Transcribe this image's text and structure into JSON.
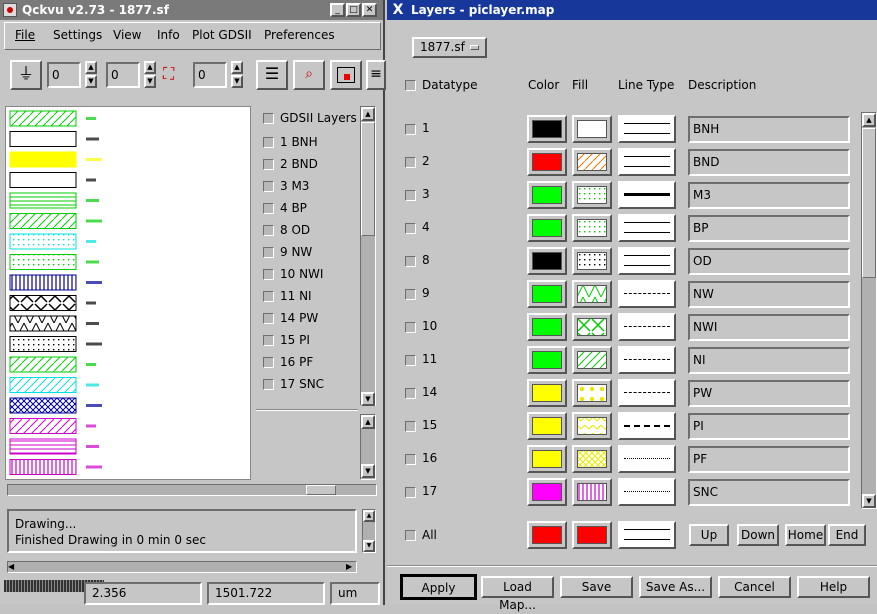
{
  "left": {
    "title": "Qckvu v2.73 - 1877.sf",
    "menu": [
      "File",
      "Settings",
      "View",
      "Info",
      "Plot GDSII",
      "Preferences"
    ],
    "spin_values": [
      "0",
      "0",
      "0"
    ],
    "layers_header": "GDSII Layers",
    "layers": [
      "1 BNH",
      "2 BND",
      "3 M3",
      "4 BP",
      "8 OD",
      "9 NW",
      "10 NWI",
      "11 NI",
      "14 PW",
      "15 PI",
      "16 PF",
      "17 SNC"
    ],
    "messages": [
      "Drawing...",
      "Finished Drawing in 0 min 0 sec"
    ],
    "coord_x": "2.356",
    "coord_y": "1501.722",
    "units": "um",
    "legend": [
      {
        "color": "#00cc00",
        "fill": "diag"
      },
      {
        "color": "#000000",
        "fill": "none"
      },
      {
        "color": "#ffff00",
        "fill": "solid"
      },
      {
        "color": "#000000",
        "fill": "none"
      },
      {
        "color": "#00cc00",
        "fill": "hlines"
      },
      {
        "color": "#00cc00",
        "fill": "diag"
      },
      {
        "color": "#00e0e0",
        "fill": "dots"
      },
      {
        "color": "#00cc00",
        "fill": "dots"
      },
      {
        "color": "#000099",
        "fill": "vlines"
      },
      {
        "color": "#000000",
        "fill": "xx"
      },
      {
        "color": "#000000",
        "fill": "zig"
      },
      {
        "color": "#000000",
        "fill": "dots"
      },
      {
        "color": "#00cc00",
        "fill": "diag"
      },
      {
        "color": "#00e0e0",
        "fill": "diag"
      },
      {
        "color": "#000099",
        "fill": "cross"
      },
      {
        "color": "#cc00cc",
        "fill": "diag"
      },
      {
        "color": "#cc00cc",
        "fill": "hlines"
      },
      {
        "color": "#cc00cc",
        "fill": "vlines"
      }
    ]
  },
  "right": {
    "title": "Layers - piclayer.map",
    "file_menu": "1877.sf",
    "headers": {
      "datatype": "Datatype",
      "color": "Color",
      "fill": "Fill",
      "linetype": "Line Type",
      "description": "Description"
    },
    "rows": [
      {
        "num": "1",
        "color": "#000000",
        "fill": "none",
        "fillc": "#000",
        "lt": "double",
        "desc": "BNH"
      },
      {
        "num": "2",
        "color": "#ff0000",
        "fill": "diag",
        "fillc": "#e87a00",
        "lt": "double",
        "desc": "BND"
      },
      {
        "num": "3",
        "color": "#00ff00",
        "fill": "dots",
        "fillc": "#00cc00",
        "lt": "thick",
        "desc": "M3"
      },
      {
        "num": "4",
        "color": "#00ff00",
        "fill": "dots",
        "fillc": "#00cc00",
        "lt": "double",
        "desc": "BP"
      },
      {
        "num": "8",
        "color": "#000000",
        "fill": "dots",
        "fillc": "#000",
        "lt": "double",
        "desc": "OD"
      },
      {
        "num": "9",
        "color": "#00ff00",
        "fill": "zig",
        "fillc": "#00cc00",
        "lt": "dash",
        "desc": "NW"
      },
      {
        "num": "10",
        "color": "#00ff00",
        "fill": "xx",
        "fillc": "#00cc00",
        "lt": "dash",
        "desc": "NWI"
      },
      {
        "num": "11",
        "color": "#00ff00",
        "fill": "diag",
        "fillc": "#00cc00",
        "lt": "dash",
        "desc": "NI"
      },
      {
        "num": "14",
        "color": "#ffff00",
        "fill": "bigdots",
        "fillc": "#e8e800",
        "lt": "dash",
        "desc": "PW"
      },
      {
        "num": "15",
        "color": "#ffff00",
        "fill": "chev",
        "fillc": "#e8e800",
        "lt": "dashwide",
        "desc": "PI"
      },
      {
        "num": "16",
        "color": "#ffff00",
        "fill": "cross",
        "fillc": "#e8e800",
        "lt": "dashdot",
        "desc": "PF"
      },
      {
        "num": "17",
        "color": "#ff00ff",
        "fill": "vlines",
        "fillc": "#cc00cc",
        "lt": "dashdot",
        "desc": "SNC"
      }
    ],
    "all_label": "All",
    "nav": [
      "Up",
      "Down",
      "Home",
      "End"
    ],
    "actions": [
      "Apply",
      "Load Map...",
      "Save",
      "Save As...",
      "Cancel",
      "Help"
    ]
  }
}
